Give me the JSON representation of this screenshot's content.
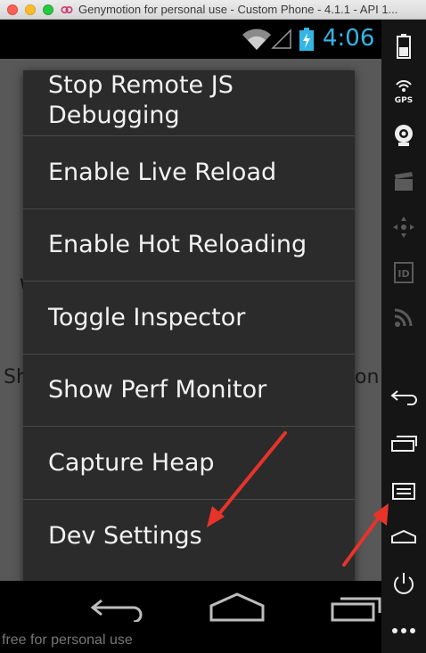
{
  "window": {
    "title": "Genymotion for personal use - Custom Phone - 4.1.1 - API 1..."
  },
  "statusbar": {
    "time": "4:06",
    "time_color": "#33b5e5"
  },
  "background_app": {
    "partial_text_left_1": "W",
    "partial_text_left_2": "Sh",
    "partial_text_right": "on"
  },
  "dev_menu": {
    "items": [
      {
        "label_line1": "Stop Remote JS",
        "label_line2": "Debugging"
      },
      {
        "label": "Enable Live Reload"
      },
      {
        "label": "Enable Hot Reloading"
      },
      {
        "label": "Toggle Inspector"
      },
      {
        "label": "Show Perf Monitor"
      },
      {
        "label": "Capture Heap"
      },
      {
        "label": "Dev Settings"
      }
    ]
  },
  "navbar": {
    "icons": [
      "back-icon",
      "home-icon",
      "recent-apps-icon"
    ]
  },
  "sidebar": {
    "gps_label": "GPS",
    "id_label": "ID",
    "icons": [
      "battery-icon",
      "gps-icon",
      "webcam-icon",
      "video-capture-icon",
      "dpad-icon",
      "device-id-icon",
      "rss-icon",
      "back-icon",
      "recent-apps-icon",
      "menu-icon",
      "home-icon",
      "power-icon",
      "more-icon"
    ]
  },
  "watermark": {
    "text": "free for personal use"
  },
  "annotations": {
    "arrow_color": "#e8332a"
  }
}
